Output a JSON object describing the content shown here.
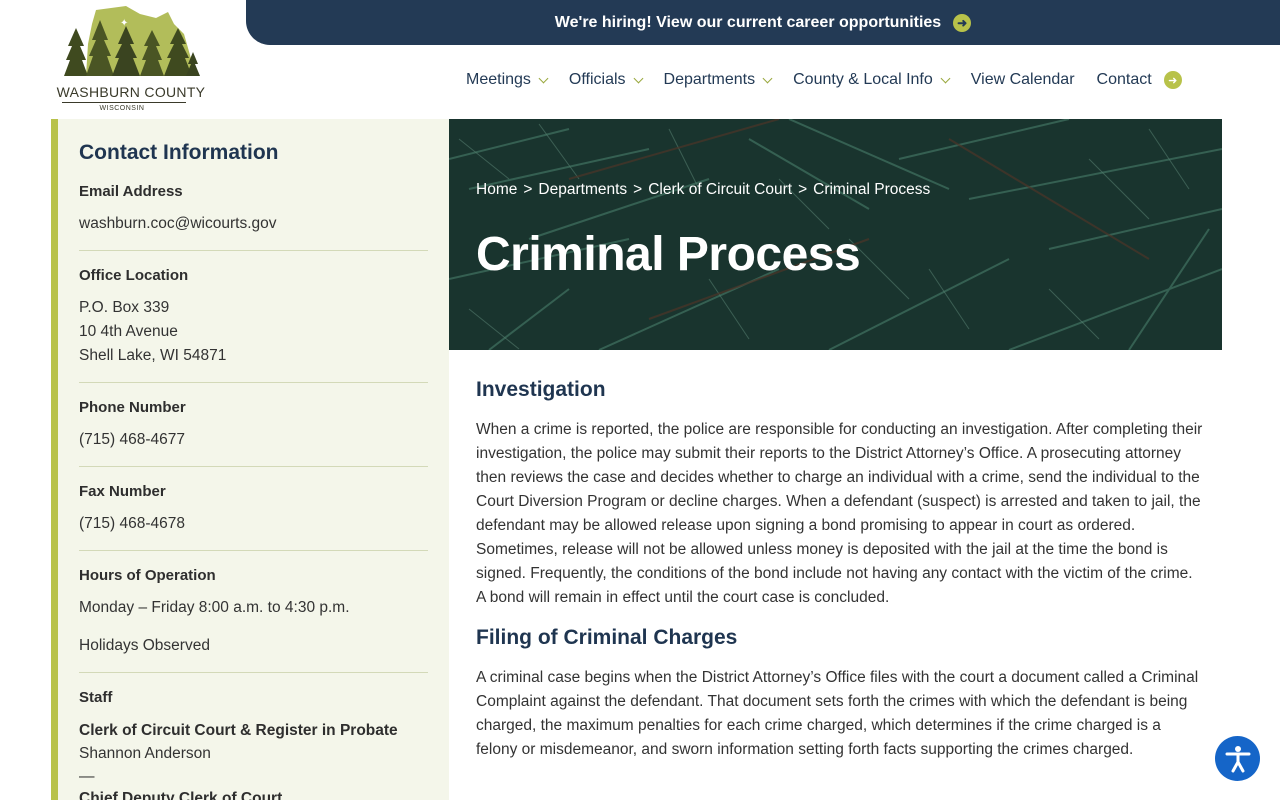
{
  "banner": {
    "text": "We're hiring! View our current career opportunities"
  },
  "logo": {
    "name": "WASHBURN COUNTY",
    "state": "WISCONSIN"
  },
  "nav": {
    "items": [
      {
        "label": "Meetings"
      },
      {
        "label": "Officials"
      },
      {
        "label": "Departments"
      },
      {
        "label": "County & Local Info"
      },
      {
        "label": "View Calendar"
      },
      {
        "label": "Contact"
      }
    ]
  },
  "sidebar": {
    "title": "Contact Information",
    "email": {
      "label": "Email Address",
      "value": "washburn.coc@wicourts.gov"
    },
    "office": {
      "label": "Office Location",
      "line1": "P.O. Box 339",
      "line2": "10 4th Avenue",
      "line3": "Shell Lake, WI 54871"
    },
    "phone": {
      "label": "Phone Number",
      "value": "(715) 468-4677"
    },
    "fax": {
      "label": "Fax Number",
      "value": "(715) 468-4678"
    },
    "hours": {
      "label": "Hours of Operation",
      "value": "Monday – Friday 8:00 a.m. to 4:30 p.m.",
      "note": "Holidays Observed"
    },
    "staff": {
      "label": "Staff",
      "members": [
        {
          "role": "Clerk of Circuit Court & Register in Probate",
          "name": "Shannon Anderson"
        },
        {
          "role": "Chief Deputy Clerk of Court",
          "name": ""
        }
      ],
      "separator": "—"
    }
  },
  "hero": {
    "breadcrumb": [
      "Home",
      "Departments",
      "Clerk of Circuit Court",
      "Criminal Process"
    ],
    "breadcrumb_sep": ">",
    "title": "Criminal Process"
  },
  "content": {
    "sections": [
      {
        "heading": "Investigation",
        "text": "When a crime is reported, the police are responsible for conducting an investigation. After completing their investigation, the police may submit their reports to the District Attorney’s Office. A prosecuting attorney then reviews the case and decides whether to charge an individual with a crime, send the individual to the Court Diversion Program or decline charges. When a defendant (suspect) is arrested and taken to jail, the defendant may be allowed release upon signing a bond promising to appear in court as ordered. Sometimes, release will not be allowed unless money is deposited with the jail at the time the bond is signed. Frequently, the conditions of the bond include not having any contact with the victim of the crime. A bond will remain in effect until the court case is concluded."
      },
      {
        "heading": "Filing of Criminal Charges",
        "text": "A criminal case begins when the District Attorney’s Office files with the court a document called a Criminal Complaint against the defendant. That document sets forth the crimes with which the defendant is being charged, the maximum penalties for each crime charged, which determines if the crime charged is a felony or misdemeanor, and sworn information setting forth facts supporting the crimes charged."
      }
    ]
  },
  "colors": {
    "navy": "#233a55",
    "accent": "#b8c24a",
    "sidebar_bg": "#f4f6ea",
    "a11y_blue": "#1565c8"
  },
  "icons": {
    "banner_arrow": "arrow-right-circle-icon",
    "a11y": "accessibility-icon"
  }
}
